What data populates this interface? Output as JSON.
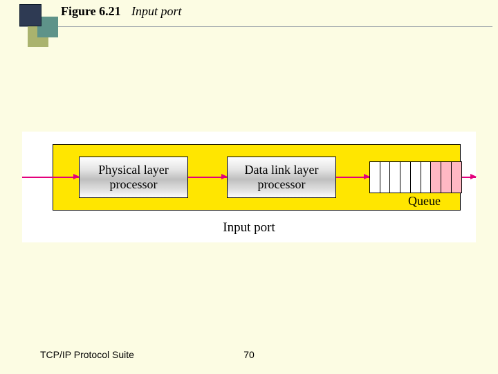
{
  "figure": {
    "label": "Figure 6.21",
    "caption": "Input port"
  },
  "diagram": {
    "box1_line1": "Physical layer",
    "box1_line2": "processor",
    "box2_line1": "Data link layer",
    "box2_line2": "processor",
    "queue_label": "Queue",
    "caption": "Input port"
  },
  "footer": {
    "left": "TCP/IP Protocol Suite",
    "page": "70"
  }
}
